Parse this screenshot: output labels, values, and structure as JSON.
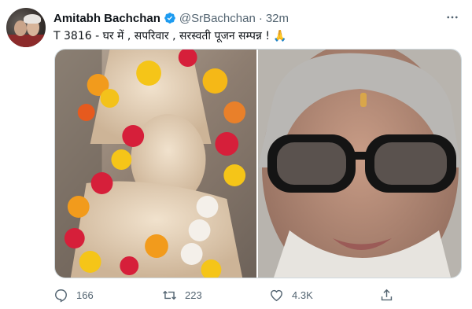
{
  "tweet": {
    "author": {
      "name": "Amitabh Bachchan",
      "handle": "@SrBachchan",
      "verified": true
    },
    "separator": "·",
    "time": "32m",
    "text": "T 3816 - घर में , सपरिवार , सरस्वती पूजन सम्पन्न  ! 🙏",
    "media": {
      "left_image": "statue-image",
      "right_image": "portrait-image"
    },
    "actions": {
      "reply_count": "166",
      "retweet_count": "223",
      "like_count": "4.3K"
    }
  },
  "colors": {
    "text": "#0f1419",
    "secondary": "#536471",
    "verified": "#1d9bf0",
    "border": "#cfd9de"
  },
  "icons": {
    "verified": "verified-badge-icon",
    "more": "more-options-icon",
    "reply": "reply-icon",
    "retweet": "retweet-icon",
    "like": "heart-icon",
    "share": "share-icon"
  }
}
